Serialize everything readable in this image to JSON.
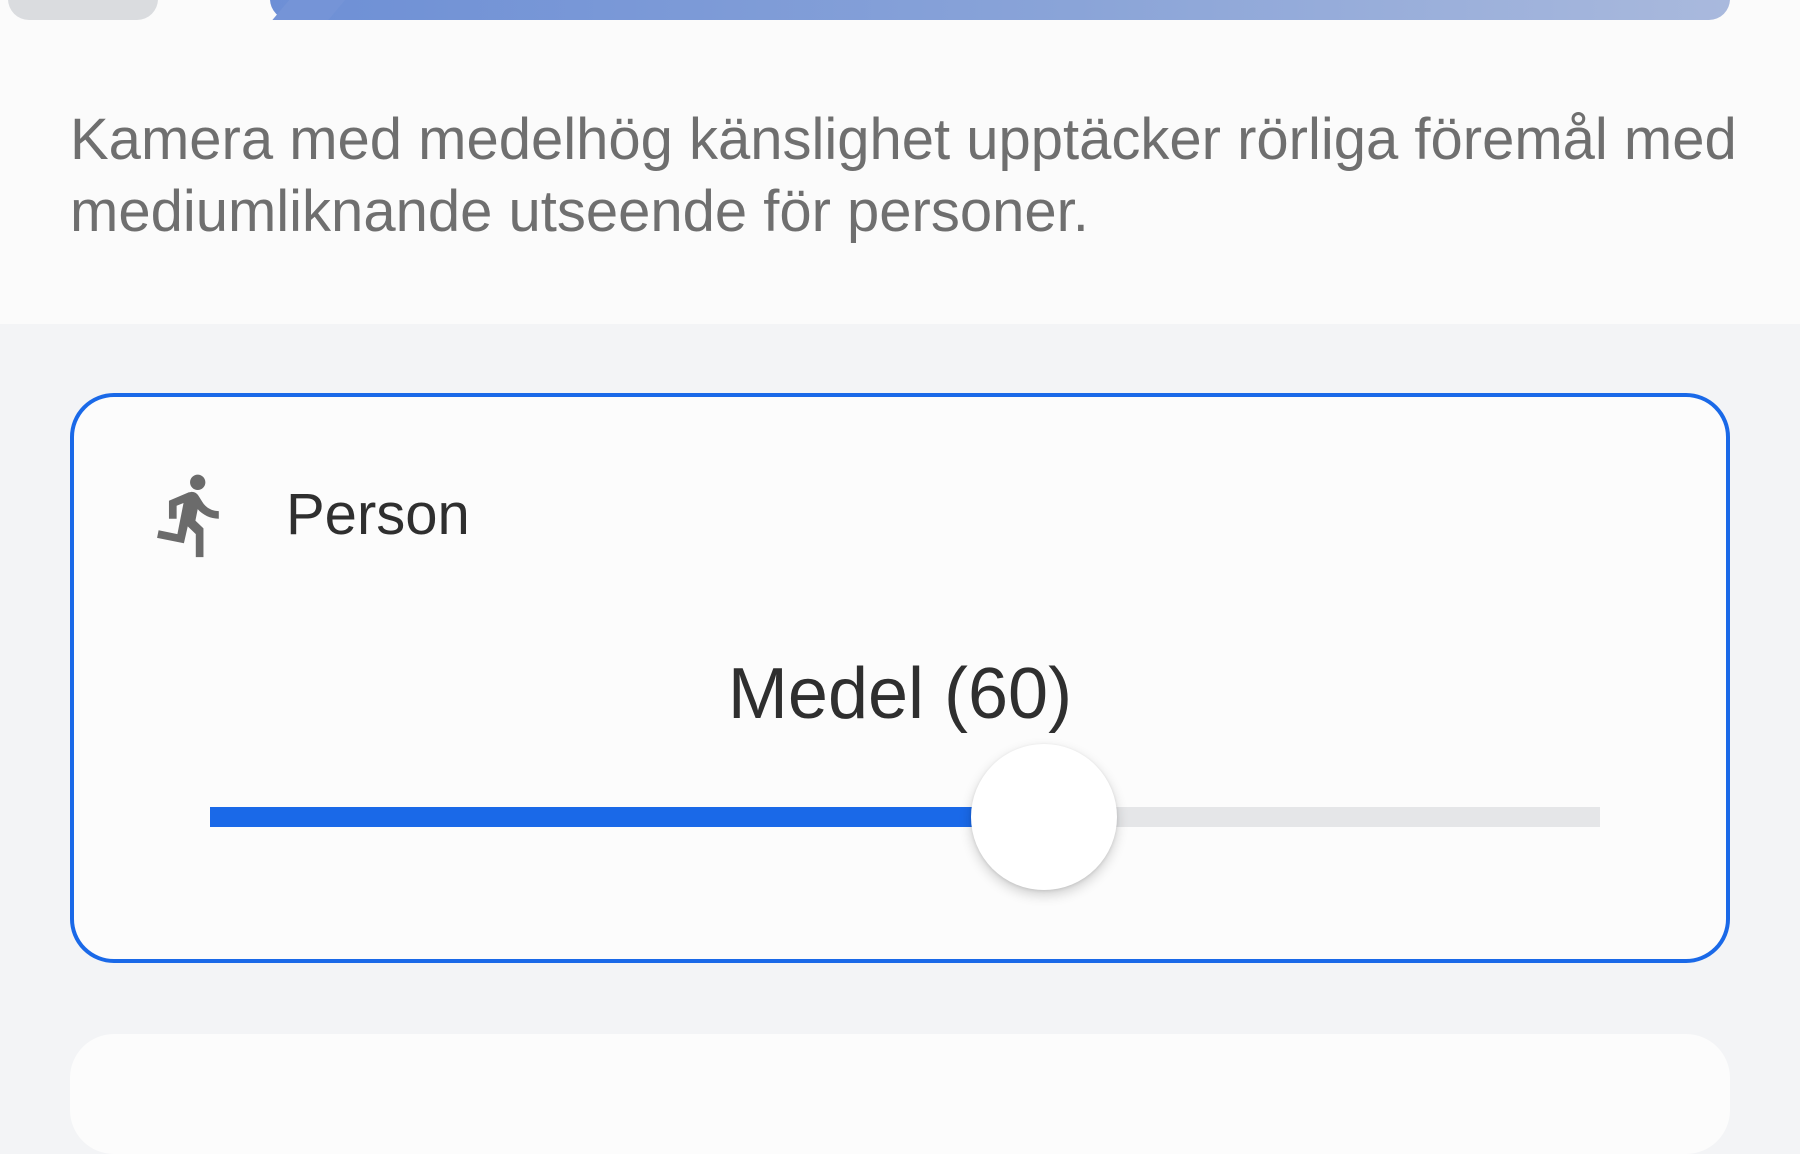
{
  "mode_strip": {
    "selected_color": "#6d8fd6"
  },
  "description": "Kamera med medelhög känslighet upptäcker rörliga föremål med mediumliknande utseende för personer.",
  "person_card": {
    "icon": "running-person-icon",
    "title": "Person",
    "slider_label": "Medel (60)",
    "slider_value": 60,
    "slider_min": 0,
    "slider_max": 100,
    "accent_color": "#1a69e8"
  }
}
